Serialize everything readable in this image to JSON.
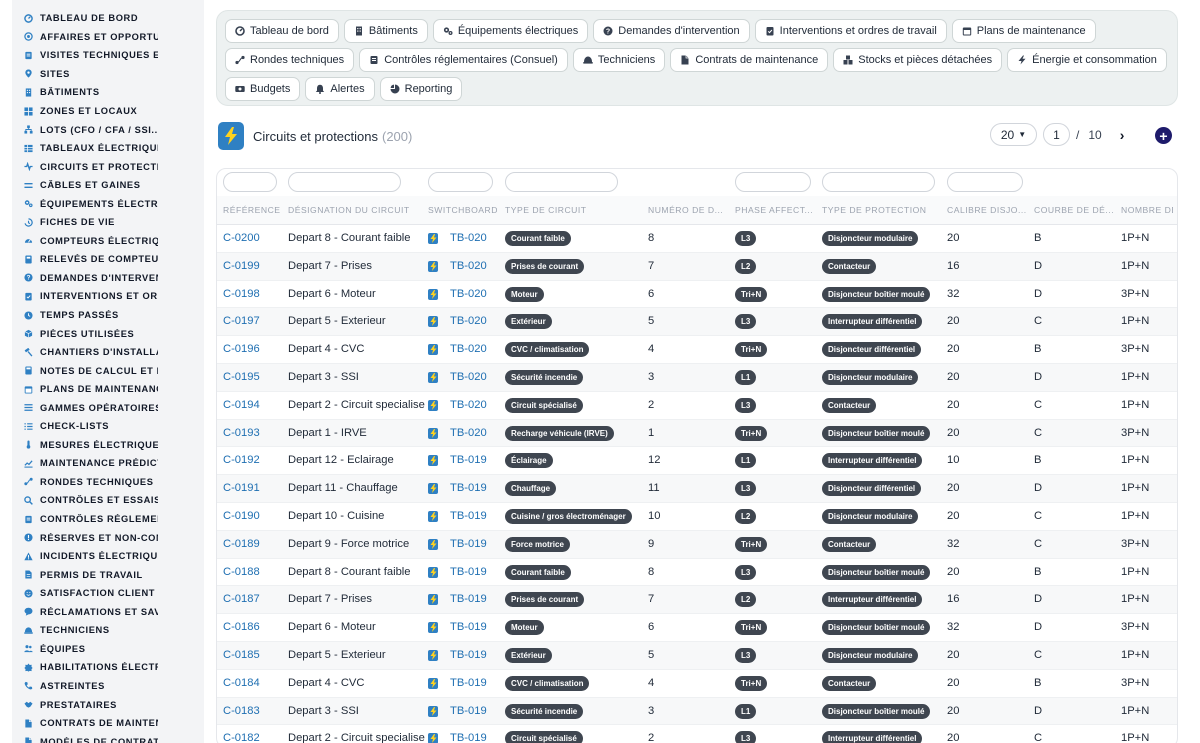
{
  "sidebar": {
    "items": [
      {
        "label": "TABLEAU DE BORD",
        "icon": "dashboard-icon"
      },
      {
        "label": "AFFAIRES ET OPPORTUNITÉS",
        "icon": "target-icon"
      },
      {
        "label": "VISITES TECHNIQUES ET RELEVÉS",
        "icon": "clipboard-icon"
      },
      {
        "label": "SITES",
        "icon": "pin-icon"
      },
      {
        "label": "BÂTIMENTS",
        "icon": "building-icon"
      },
      {
        "label": "ZONES ET LOCAUX",
        "icon": "grid-icon"
      },
      {
        "label": "LOTS (CFO / CFA / SSI...)",
        "icon": "hierarchy-icon"
      },
      {
        "label": "TABLEAUX ÉLECTRIQUES",
        "icon": "table-icon"
      },
      {
        "label": "CIRCUITS ET PROTECTIONS",
        "icon": "circuit-icon"
      },
      {
        "label": "CÂBLES ET GAINES",
        "icon": "cable-icon"
      },
      {
        "label": "ÉQUIPEMENTS ÉLECTRIQUES",
        "icon": "gears-icon"
      },
      {
        "label": "FICHES DE VIE",
        "icon": "history-icon"
      },
      {
        "label": "COMPTEURS ÉLECTRIQUES",
        "icon": "gauge-icon"
      },
      {
        "label": "RELEVÉS DE COMPTEURS",
        "icon": "reading-icon"
      },
      {
        "label": "DEMANDES D'INTERVENTION",
        "icon": "question-icon"
      },
      {
        "label": "INTERVENTIONS ET ORDRES",
        "icon": "clipboard-check-icon"
      },
      {
        "label": "TEMPS PASSÉS",
        "icon": "clock-icon"
      },
      {
        "label": "PIÈCES UTILISÉES",
        "icon": "box-icon"
      },
      {
        "label": "CHANTIERS D'INSTALLATION",
        "icon": "hammer-icon"
      },
      {
        "label": "NOTES DE CALCUL ET ÉTUDES",
        "icon": "calculator-icon"
      },
      {
        "label": "PLANS DE MAINTENANCE",
        "icon": "calendar-icon"
      },
      {
        "label": "GAMMES OPÉRATOIRES",
        "icon": "list-icon"
      },
      {
        "label": "CHECK-LISTS",
        "icon": "checklist-icon"
      },
      {
        "label": "MESURES ÉLECTRIQUES",
        "icon": "thermometer-icon"
      },
      {
        "label": "MAINTENANCE PRÉDICTIVE",
        "icon": "chart-icon"
      },
      {
        "label": "RONDES TECHNIQUES",
        "icon": "route-icon"
      },
      {
        "label": "CONTRÔLES ET ESSAIS",
        "icon": "search-icon"
      },
      {
        "label": "CONTRÔLES RÉGLEMENTAIRES",
        "icon": "clipboard-icon"
      },
      {
        "label": "RÉSERVES ET NON-CONFORMITÉS",
        "icon": "alert-circle-icon"
      },
      {
        "label": "INCIDENTS ÉLECTRIQUES",
        "icon": "warning-icon"
      },
      {
        "label": "PERMIS DE TRAVAIL",
        "icon": "document-icon"
      },
      {
        "label": "SATISFACTION CLIENT",
        "icon": "smile-icon"
      },
      {
        "label": "RÉCLAMATIONS ET SAV",
        "icon": "comment-icon"
      },
      {
        "label": "TECHNICIENS",
        "icon": "helmet-icon"
      },
      {
        "label": "ÉQUIPES",
        "icon": "users-icon"
      },
      {
        "label": "HABILITATIONS ÉLECTRIQUES",
        "icon": "badge-icon"
      },
      {
        "label": "ASTREINTES",
        "icon": "phone-icon"
      },
      {
        "label": "PRESTATAIRES",
        "icon": "handshake-icon"
      },
      {
        "label": "CONTRATS DE MAINTENANCE",
        "icon": "file-icon"
      },
      {
        "label": "MODÈLES DE CONTRATS",
        "icon": "file-icon"
      }
    ]
  },
  "nav": {
    "buttons": [
      {
        "label": "Tableau de bord",
        "icon": "dashboard-icon"
      },
      {
        "label": "Bâtiments",
        "icon": "building-icon"
      },
      {
        "label": "Équipements électriques",
        "icon": "gears-icon"
      },
      {
        "label": "Demandes d'intervention",
        "icon": "question-icon"
      },
      {
        "label": "Interventions et ordres de travail",
        "icon": "clipboard-check-icon"
      },
      {
        "label": "Plans de maintenance",
        "icon": "calendar-icon"
      },
      {
        "label": "Rondes techniques",
        "icon": "route-icon"
      },
      {
        "label": "Contrôles réglementaires (Consuel)",
        "icon": "clipboard-icon"
      },
      {
        "label": "Techniciens",
        "icon": "helmet-icon"
      },
      {
        "label": "Contrats de maintenance",
        "icon": "file-icon"
      },
      {
        "label": "Stocks et pièces détachées",
        "icon": "boxes-icon"
      },
      {
        "label": "Énergie et consommation",
        "icon": "bolt-icon"
      },
      {
        "label": "Budgets",
        "icon": "money-icon"
      },
      {
        "label": "Alertes",
        "icon": "bell-icon"
      },
      {
        "label": "Reporting",
        "icon": "pie-icon"
      }
    ]
  },
  "header": {
    "title": "Circuits et protections",
    "count": "(200)",
    "icon": "bolt-icon",
    "accent": "#2f80c3"
  },
  "pager": {
    "per_page": "20",
    "current_page": "1",
    "separator": "/",
    "total_pages": "10",
    "next": "›",
    "add": "+"
  },
  "table": {
    "columns": [
      "RÉFÉRENCE",
      "DÉSIGNATION DU CIRCUIT",
      "SWITCHBOARD",
      "TYPE DE CIRCUIT",
      "NUMÉRO DE D...",
      "PHASE AFFECT...",
      "TYPE DE PROTECTION",
      "CALIBRE DISJO...",
      "COURBE DE DÉ...",
      "NOMBRE DE"
    ],
    "rows": [
      [
        "C-0200",
        "Depart 8 - Courant faible",
        "TB-020",
        "Courant faible",
        "8",
        "L3",
        "Disjoncteur modulaire",
        "20",
        "B",
        "1P+N"
      ],
      [
        "C-0199",
        "Depart 7 - Prises",
        "TB-020",
        "Prises de courant",
        "7",
        "L2",
        "Contacteur",
        "16",
        "D",
        "1P+N"
      ],
      [
        "C-0198",
        "Depart 6 - Moteur",
        "TB-020",
        "Moteur",
        "6",
        "Tri+N",
        "Disjoncteur boîtier moulé",
        "32",
        "D",
        "3P+N"
      ],
      [
        "C-0197",
        "Depart 5 - Exterieur",
        "TB-020",
        "Extérieur",
        "5",
        "L3",
        "Interrupteur différentiel",
        "20",
        "C",
        "1P+N"
      ],
      [
        "C-0196",
        "Depart 4 - CVC",
        "TB-020",
        "CVC / climatisation",
        "4",
        "Tri+N",
        "Disjoncteur différentiel",
        "20",
        "B",
        "3P+N"
      ],
      [
        "C-0195",
        "Depart 3 - SSI",
        "TB-020",
        "Sécurité incendie",
        "3",
        "L1",
        "Disjoncteur modulaire",
        "20",
        "D",
        "1P+N"
      ],
      [
        "C-0194",
        "Depart 2 - Circuit specialise",
        "TB-020",
        "Circuit spécialisé",
        "2",
        "L3",
        "Contacteur",
        "20",
        "C",
        "1P+N"
      ],
      [
        "C-0193",
        "Depart 1 - IRVE",
        "TB-020",
        "Recharge véhicule (IRVE)",
        "1",
        "Tri+N",
        "Disjoncteur boîtier moulé",
        "20",
        "C",
        "3P+N"
      ],
      [
        "C-0192",
        "Depart 12 - Eclairage",
        "TB-019",
        "Éclairage",
        "12",
        "L1",
        "Interrupteur différentiel",
        "10",
        "B",
        "1P+N"
      ],
      [
        "C-0191",
        "Depart 11 - Chauffage",
        "TB-019",
        "Chauffage",
        "11",
        "L3",
        "Disjoncteur différentiel",
        "20",
        "D",
        "1P+N"
      ],
      [
        "C-0190",
        "Depart 10 - Cuisine",
        "TB-019",
        "Cuisine / gros électroménager",
        "10",
        "L2",
        "Disjoncteur modulaire",
        "20",
        "C",
        "1P+N"
      ],
      [
        "C-0189",
        "Depart 9 - Force motrice",
        "TB-019",
        "Force motrice",
        "9",
        "Tri+N",
        "Contacteur",
        "32",
        "C",
        "3P+N"
      ],
      [
        "C-0188",
        "Depart 8 - Courant faible",
        "TB-019",
        "Courant faible",
        "8",
        "L3",
        "Disjoncteur boîtier moulé",
        "20",
        "B",
        "1P+N"
      ],
      [
        "C-0187",
        "Depart 7 - Prises",
        "TB-019",
        "Prises de courant",
        "7",
        "L2",
        "Interrupteur différentiel",
        "16",
        "D",
        "1P+N"
      ],
      [
        "C-0186",
        "Depart 6 - Moteur",
        "TB-019",
        "Moteur",
        "6",
        "Tri+N",
        "Disjoncteur boîtier moulé",
        "32",
        "D",
        "3P+N"
      ],
      [
        "C-0185",
        "Depart 5 - Exterieur",
        "TB-019",
        "Extérieur",
        "5",
        "L3",
        "Disjoncteur modulaire",
        "20",
        "C",
        "1P+N"
      ],
      [
        "C-0184",
        "Depart 4 - CVC",
        "TB-019",
        "CVC / climatisation",
        "4",
        "Tri+N",
        "Contacteur",
        "20",
        "B",
        "3P+N"
      ],
      [
        "C-0183",
        "Depart 3 - SSI",
        "TB-019",
        "Sécurité incendie",
        "3",
        "L1",
        "Disjoncteur boîtier moulé",
        "20",
        "D",
        "1P+N"
      ],
      [
        "C-0182",
        "Depart 2 - Circuit specialise",
        "TB-019",
        "Circuit spécialisé",
        "2",
        "L3",
        "Interrupteur différentiel",
        "20",
        "C",
        "1P+N"
      ]
    ]
  }
}
